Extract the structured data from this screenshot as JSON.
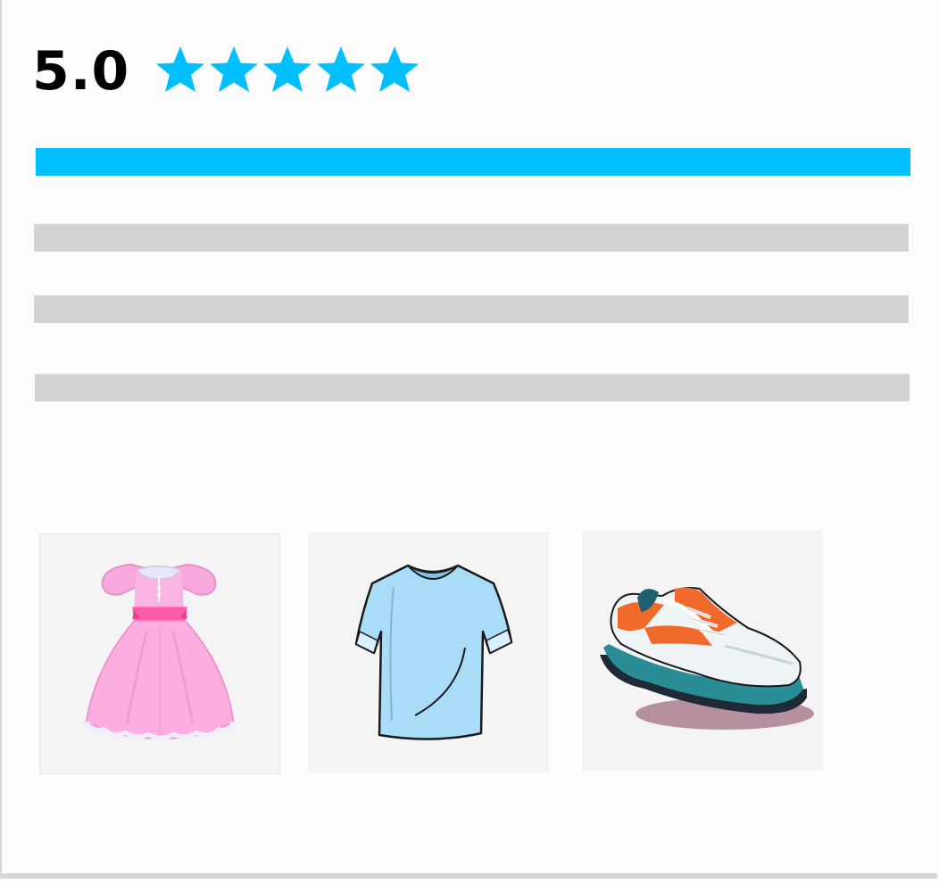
{
  "rating": {
    "score_label": "5.0",
    "stars_filled": 5,
    "stars_total": 5,
    "star_color": "#00bfff"
  },
  "distribution": {
    "fill_color": "#00bfff",
    "track_color": "#d3d3d3",
    "bars": [
      {
        "fraction": 1.0
      },
      {
        "fraction": 0.0
      },
      {
        "fraction": 0.0
      },
      {
        "fraction": 0.0
      }
    ]
  },
  "gallery": {
    "images": [
      {
        "icon": "pink-dress-image"
      },
      {
        "icon": "blue-tshirt-image"
      },
      {
        "icon": "sneaker-image"
      }
    ]
  }
}
